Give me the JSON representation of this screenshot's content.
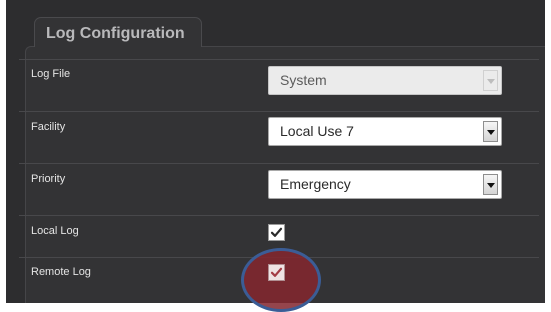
{
  "panel": {
    "title": "Log Configuration"
  },
  "fields": {
    "log_file": {
      "label": "Log File",
      "value": "System",
      "disabled": true
    },
    "facility": {
      "label": "Facility",
      "value": "Local Use 7"
    },
    "priority": {
      "label": "Priority",
      "value": "Emergency"
    },
    "local_log": {
      "label": "Local Log",
      "checked": true
    },
    "remote_log": {
      "label": "Remote Log",
      "checked": true,
      "highlighted": true
    }
  },
  "colors": {
    "background": "#2d2d2f",
    "text": "#e4e4e4",
    "highlight_fill": "#84262e",
    "highlight_ring": "#3b5d96"
  },
  "icons": {
    "checkmark": "checkmark-icon",
    "dropdown": "chevron-down-icon"
  }
}
